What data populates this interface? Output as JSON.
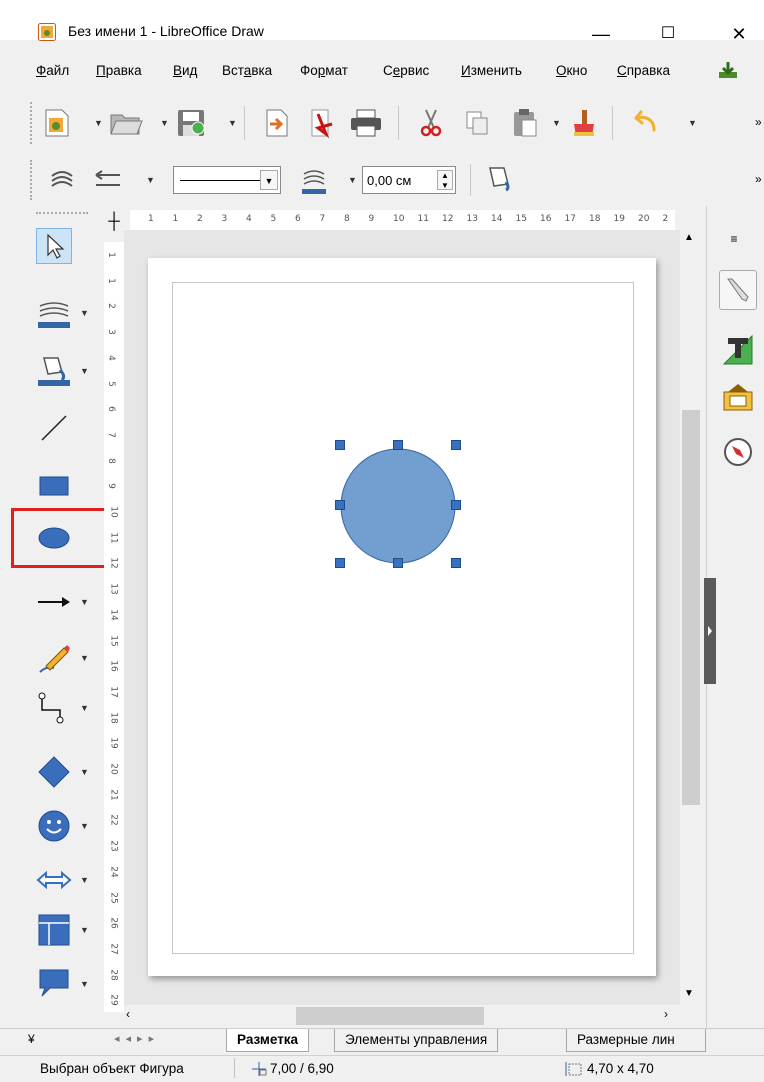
{
  "window": {
    "title": "Без имени 1 - LibreOffice Draw",
    "minimize": "—",
    "maximize": "☐",
    "close": "✕"
  },
  "menu": [
    {
      "label": "Файл",
      "u": "Ф",
      "rest": "айл"
    },
    {
      "label": "Правка",
      "u": "П",
      "rest": "равка"
    },
    {
      "label": "Вид",
      "u": "В",
      "rest": "ид"
    },
    {
      "label": "Вставка",
      "pre": "Вст",
      "u": "а",
      "rest": "вка"
    },
    {
      "label": "Формат",
      "pre": "Фо",
      "u": "р",
      "rest": "мат"
    },
    {
      "label": "Сервис",
      "pre": "С",
      "u": "е",
      "rest": "рвис"
    },
    {
      "label": "Изменить",
      "u": "И",
      "rest": "зменить"
    },
    {
      "label": "Окно",
      "u": "О",
      "rest": "кно"
    },
    {
      "label": "Справка",
      "u": "С",
      "rest": "правка"
    }
  ],
  "line_toolbar": {
    "line_width_value": "0,00 см"
  },
  "hruler_ticks": [
    "1",
    "1",
    "2",
    "3",
    "4",
    "5",
    "6",
    "7",
    "8",
    "9",
    "10",
    "11",
    "12",
    "13",
    "14",
    "15",
    "16",
    "17",
    "18",
    "19",
    "20",
    "2"
  ],
  "vruler_ticks": [
    "1",
    "1",
    "2",
    "3",
    "4",
    "5",
    "6",
    "7",
    "8",
    "9",
    "10",
    "11",
    "12",
    "13",
    "14",
    "15",
    "16",
    "17",
    "18",
    "19",
    "20",
    "21",
    "22",
    "23",
    "24",
    "25",
    "26",
    "27",
    "28",
    "29"
  ],
  "shape": {
    "type": "circle",
    "fill": "#729fcf",
    "border": "#3465a4"
  },
  "tabs": [
    {
      "label": "Разметка",
      "active": true
    },
    {
      "label": "Элементы управления",
      "active": false
    },
    {
      "label": "Размерные лин",
      "active": false
    }
  ],
  "status": {
    "selection": "Выбран объект Фигура",
    "position": "7,00 / 6,90",
    "size": "4,70 x 4,70"
  },
  "colors": {
    "accent": "#3465a4",
    "highlight": "#e0201a",
    "shape_fill": "#729fcf"
  }
}
